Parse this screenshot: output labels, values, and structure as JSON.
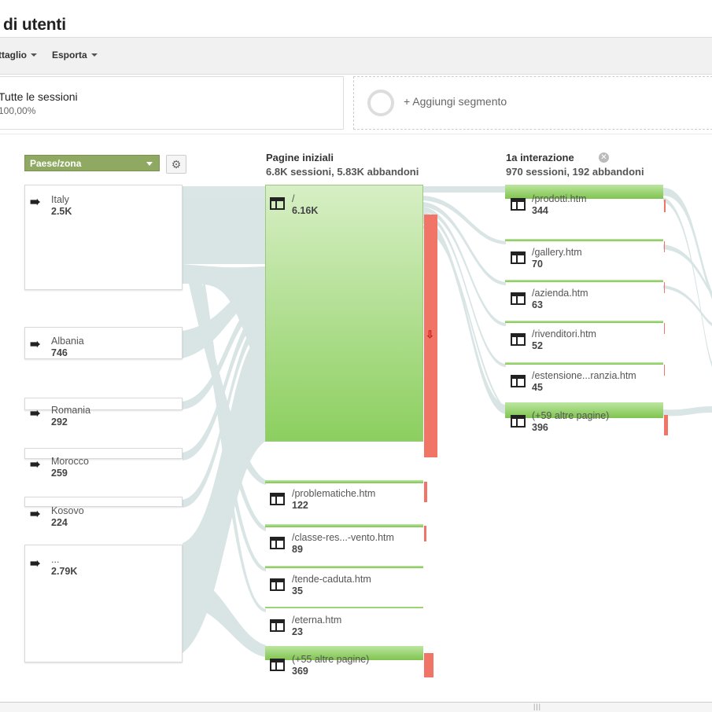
{
  "header": {
    "title": "di utenti"
  },
  "toolbar": {
    "items": [
      "ttaglio",
      "Esporta"
    ]
  },
  "segments": {
    "active": {
      "name": "Tutte le sessioni",
      "pct": "100,00%"
    },
    "add_label": "+ Aggiungi segmento"
  },
  "dimension": {
    "selector": "Paese/zona"
  },
  "columns": {
    "starting": {
      "title": "Pagine iniziali",
      "subtitle": "6.8K sessioni, 5.83K abbandoni"
    },
    "first": {
      "title": "1a interazione",
      "subtitle": "970 sessioni, 192 abbandoni"
    }
  },
  "countries": [
    {
      "label": "Italy",
      "value": "2.5K"
    },
    {
      "label": "Albania",
      "value": "746"
    },
    {
      "label": "Romania",
      "value": "292"
    },
    {
      "label": "Morocco",
      "value": "259"
    },
    {
      "label": "Kosovo",
      "value": "224"
    },
    {
      "label": "...",
      "value": "2.79K"
    }
  ],
  "start_pages": [
    {
      "label": "/",
      "value": "6.16K"
    },
    {
      "label": "/problematiche.htm",
      "value": "122"
    },
    {
      "label": "/classe-res...-vento.htm",
      "value": "89"
    },
    {
      "label": "/tende-caduta.htm",
      "value": "35"
    },
    {
      "label": "/eterna.htm",
      "value": "23"
    },
    {
      "label": "(+55 altre pagine)",
      "value": "369"
    }
  ],
  "first_pages": [
    {
      "label": "/prodotti.htm",
      "value": "344"
    },
    {
      "label": "/gallery.htm",
      "value": "70"
    },
    {
      "label": "/azienda.htm",
      "value": "63"
    },
    {
      "label": "/rivenditori.htm",
      "value": "52"
    },
    {
      "label": "/estensione...ranzia.htm",
      "value": "45"
    },
    {
      "label": "(+59 altre pagine)",
      "value": "396"
    }
  ],
  "icons": {
    "country": "arrow-right-icon",
    "page": "page-layout-icon",
    "drop": "drop-off-arrow-icon",
    "gear": "gear-icon",
    "close": "close-icon"
  },
  "colors": {
    "node_green": "#8ccf5f",
    "dropoff_red": "#f07566",
    "flow": "#d3e0e0",
    "dimension": "#8fa962"
  }
}
